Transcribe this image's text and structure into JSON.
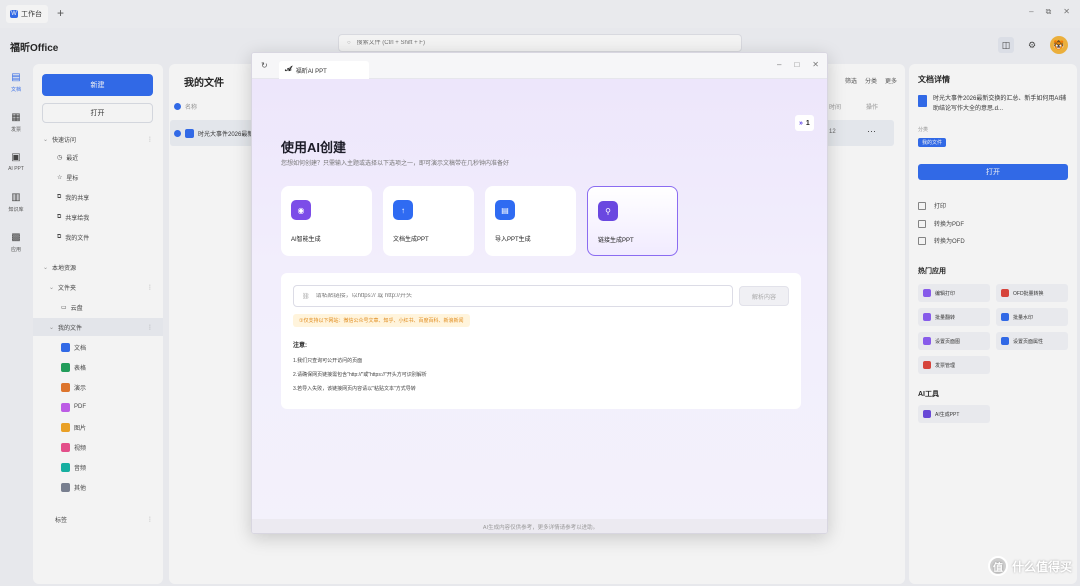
{
  "titlebar": {
    "tab_label": "工作台",
    "tab_logo": "W",
    "new_tab": "+",
    "minimize": "–",
    "restore": "⧉",
    "close": "✕"
  },
  "app": {
    "name": "福昕Office",
    "search_placeholder": "搜索文件 (Ctrl + Shift + F)"
  },
  "rail": [
    {
      "label": "文档",
      "icon": "document-icon"
    },
    {
      "label": "发票",
      "icon": "invoice-icon"
    },
    {
      "label": "AI PPT",
      "icon": "ai-ppt-icon"
    },
    {
      "label": "知识库",
      "icon": "knowledge-icon"
    },
    {
      "label": "应用",
      "icon": "apps-icon"
    }
  ],
  "sidebar": {
    "new_label": "新建",
    "open_label": "打开",
    "quick_access": "快速访问",
    "quick_items": [
      "最近",
      "星标",
      "我的共享",
      "共享给我",
      "我的文件"
    ],
    "local": "本地资源",
    "folder": "文件夹",
    "folder_item": "云盘",
    "my_files": "我的文件",
    "types": [
      {
        "label": "文档",
        "color": "#2f6bf2"
      },
      {
        "label": "表格",
        "color": "#1fa35c"
      },
      {
        "label": "演示",
        "color": "#e8782a"
      },
      {
        "label": "PDF",
        "color": "#c45df0"
      },
      {
        "label": "图片",
        "color": "#f5a623"
      },
      {
        "label": "视频",
        "color": "#ee4f8e"
      },
      {
        "label": "音频",
        "color": "#13b6a6"
      },
      {
        "label": "其他",
        "color": "#7b8394"
      }
    ],
    "tags": "标签"
  },
  "main": {
    "title": "我的文件",
    "actions": [
      "筛选",
      "分类",
      "更多"
    ],
    "col_name": "名称",
    "col_time": "时间",
    "col_op": "操作",
    "row_name": "时光大事件2026最新…",
    "row_time": "12",
    "row_more": "···"
  },
  "rpanel": {
    "title": "文档详情",
    "file_name": "时光大事件2026最新交换的汇总、新手如何用AI辅助结论写作大全的意思.d...",
    "category_label": "分类",
    "badge": "我的文件",
    "open_label": "打开",
    "actions": [
      "打印",
      "转换为PDF",
      "转换为OFD"
    ],
    "hot_title": "热门应用",
    "tools": [
      {
        "label": "编辑打印",
        "color": "#8b5cf6"
      },
      {
        "label": "OFD批量转换",
        "color": "#e0433a"
      },
      {
        "label": "批量翻转",
        "color": "#8b5cf6"
      },
      {
        "label": "批量水印",
        "color": "#2f6bf2"
      },
      {
        "label": "设置页面图",
        "color": "#8b5cf6"
      },
      {
        "label": "设置页面属性",
        "color": "#2f6bf2"
      },
      {
        "label": "发票管理",
        "color": "#e0433a"
      }
    ],
    "ai_title": "AI工具",
    "ai_tool": "AI生成PPT"
  },
  "modal": {
    "tab_label": "福昕AI PPT",
    "counter": "1",
    "heading": "使用AI创建",
    "subtitle": "您想如何创建？只需输入主题或选择以下选项之一，即可演示文稿带在几秒钟内准备好",
    "cards": [
      {
        "label": "AI智能生成",
        "color": "#7c4de8",
        "selected": false
      },
      {
        "label": "文档生成PPT",
        "color": "#2f6bf2",
        "selected": false
      },
      {
        "label": "导入PPT生成",
        "color": "#2f6bf2",
        "selected": false
      },
      {
        "label": "链接生成PPT",
        "color": "#6a48e0",
        "selected": true
      }
    ],
    "link_placeholder": "请粘贴链接，以https:// 或 http://开头",
    "parse_label": "解析内容",
    "support_tip": "①仅支持以下网站：微信公众号文章、知乎、小红书、百度百科、新浪新闻",
    "notice_title": "注意:",
    "notices": [
      "1.我们只查询可公开访问的页面",
      "2.请确保网页链接需包含\"http://\"或\"https://\"开头方可识别解析",
      "3.若导入失败，该链接网页内容请以\"粘贴文本\"方式导转"
    ],
    "footer": "AI生成内容仅供参考，更多详情请参考以进助。"
  },
  "watermark": "什么值得买"
}
